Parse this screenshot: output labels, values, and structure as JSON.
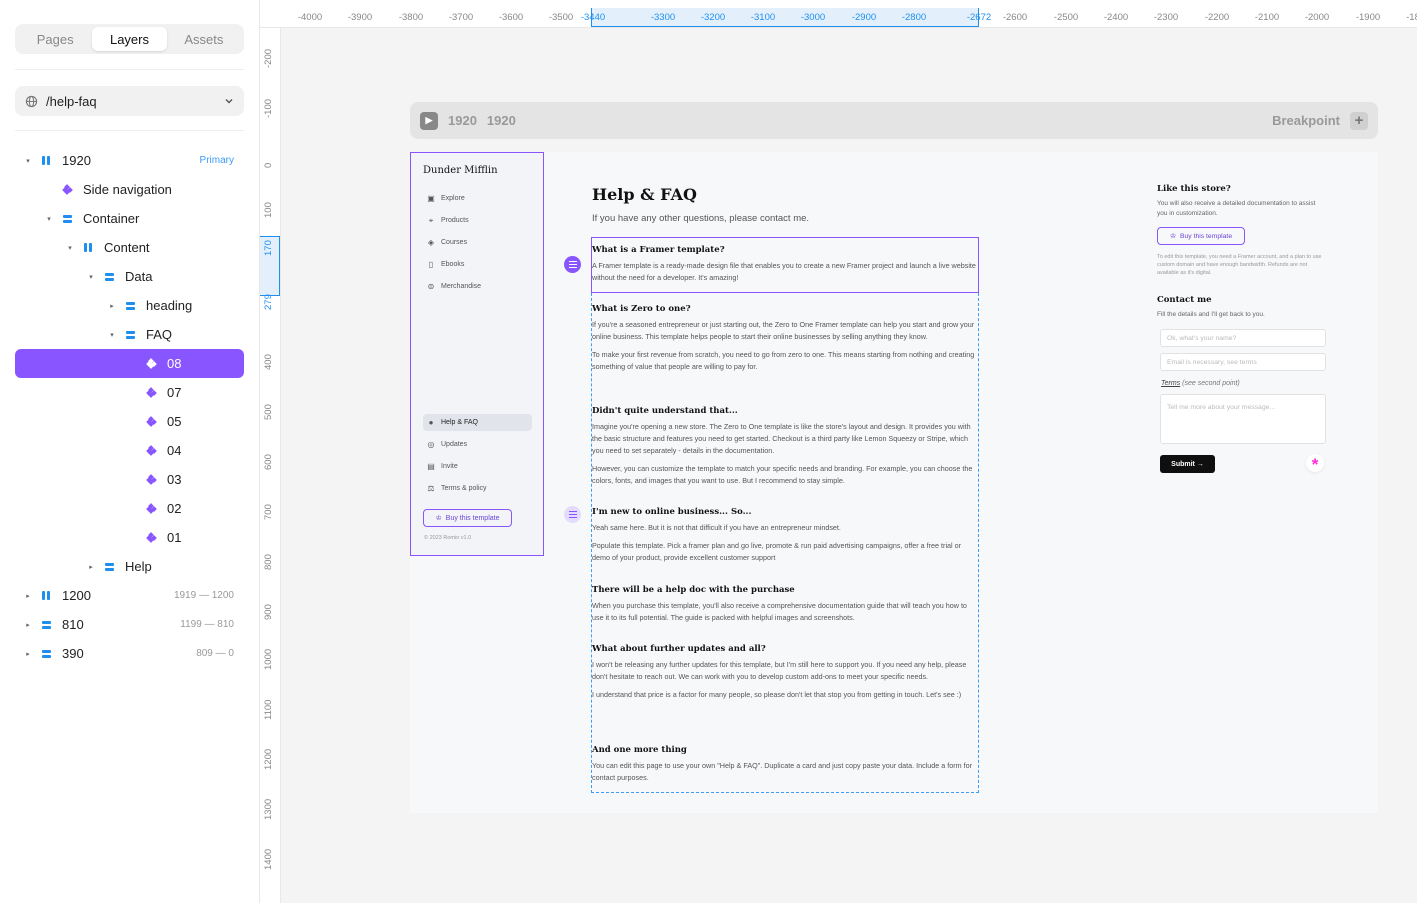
{
  "panel": {
    "tabs": [
      {
        "label": "Pages"
      },
      {
        "label": "Layers"
      },
      {
        "label": "Assets"
      }
    ],
    "page": "/help-faq"
  },
  "layers": [
    {
      "label": "1920",
      "meta": "Primary",
      "icon": "column-stack-icon"
    },
    {
      "label": "Side navigation",
      "meta": "",
      "icon": "component-icon"
    },
    {
      "label": "Container",
      "meta": "",
      "icon": "row-stack-icon"
    },
    {
      "label": "Content",
      "meta": "",
      "icon": "column-stack-icon"
    },
    {
      "label": "Data",
      "meta": "",
      "icon": "row-stack-icon"
    },
    {
      "label": "heading",
      "meta": "",
      "icon": "row-stack-icon"
    },
    {
      "label": "FAQ",
      "meta": "",
      "icon": "row-stack-icon"
    },
    {
      "label": "08",
      "meta": "",
      "icon": "component-icon",
      "selected": true
    },
    {
      "label": "07",
      "meta": "",
      "icon": "component-icon"
    },
    {
      "label": "05",
      "meta": "",
      "icon": "component-icon"
    },
    {
      "label": "04",
      "meta": "",
      "icon": "component-icon"
    },
    {
      "label": "03",
      "meta": "",
      "icon": "component-icon"
    },
    {
      "label": "02",
      "meta": "",
      "icon": "component-icon"
    },
    {
      "label": "01",
      "meta": "",
      "icon": "component-icon"
    },
    {
      "label": "Help",
      "meta": "",
      "icon": "row-stack-icon"
    },
    {
      "label": "1200",
      "meta": "1919 — 1200",
      "icon": "column-stack-icon"
    },
    {
      "label": "810",
      "meta": "1199 — 810",
      "icon": "row-stack-icon"
    },
    {
      "label": "390",
      "meta": "809 — 0",
      "icon": "row-stack-icon"
    }
  ],
  "ruler_top": [
    "-4000",
    "-3900",
    "-3800",
    "-3700",
    "-3600",
    "-3500",
    "-3440",
    "-3300",
    "-3200",
    "-3100",
    "-3000",
    "-2900",
    "-2800",
    "-2672",
    "-2600",
    "-2500",
    "-2400",
    "-2300",
    "-2200",
    "-2100",
    "-2000",
    "-1900",
    "-18"
  ],
  "ruler_left": [
    "-200",
    "-100",
    "0",
    "100",
    "170",
    "279",
    "400",
    "500",
    "600",
    "700",
    "800",
    "900",
    "1000",
    "1100",
    "1200",
    "1300",
    "1400"
  ],
  "frame_bar": {
    "width1": "1920",
    "width2": "1920",
    "breakpoint": "Breakpoint",
    "plus": "+"
  },
  "site": {
    "brand": "Dunder Mifflin",
    "nav_top": [
      {
        "label": "Explore",
        "icon": "explore-icon"
      },
      {
        "label": "Products",
        "icon": "products-icon"
      },
      {
        "label": "Courses",
        "icon": "courses-icon"
      },
      {
        "label": "Ebooks",
        "icon": "ebooks-icon"
      },
      {
        "label": "Merchandise",
        "icon": "merchandise-icon"
      }
    ],
    "nav_bottom": [
      {
        "label": "Help & FAQ",
        "icon": "info-icon"
      },
      {
        "label": "Updates",
        "icon": "updates-icon"
      },
      {
        "label": "Invite",
        "icon": "invite-icon"
      },
      {
        "label": "Terms & policy",
        "icon": "terms-icon"
      }
    ],
    "buy_button": "Buy this template",
    "copyright": "© 2023 Romio v1.0",
    "title": "Help & FAQ",
    "subtitle": "If you have any other questions, please contact me.",
    "faqs": [
      {
        "q": "What is a Framer template?",
        "a": [
          "A Framer template is a ready-made design file that enables you to create a new Framer project and launch a live website without the need for a developer. It's amazing!"
        ]
      },
      {
        "q": "What is Zero to one?",
        "a": [
          "If you're a seasoned entrepreneur or just starting out, the Zero to One Framer template can help you start and grow your online business. This template helps people to start their online businesses by selling anything they know.",
          "To make your first revenue from scratch, you need to go from zero to one. This means starting from nothing and creating something of value that people are willing to pay for."
        ]
      },
      {
        "q": "Didn't quite understand that...",
        "a": [
          "Imagine you're opening a new store. The Zero to One template is like the store's layout and design. It provides you with the basic structure and features you need to get started. Checkout is a third party like Lemon Squeezy or Stripe, which you need to set separately - details in the documentation.",
          "However, you can customize the template to match your specific needs and branding. For example, you can choose the colors, fonts, and images that you want to use. But I recommend to stay simple."
        ]
      },
      {
        "q": "I'm new to online business... So...",
        "a": [
          "Yeah same here. But it is not that difficult if you have an entrepreneur mindset.",
          "Populate this template. Pick a framer plan and go live, promote & run paid advertising campaigns, offer a free trial or demo of your product, provide excellent customer support"
        ]
      },
      {
        "q": "There will be a help doc with the purchase",
        "a": [
          "When you purchase this template, you'll also receive a comprehensive documentation guide that will teach you how to use it to its full potential. The guide is packed with helpful images and screenshots."
        ]
      },
      {
        "q": "What about further updates and all?",
        "a": [
          "I won't be releasing any further updates for this template, but I'm still here to support you. If you need any help, please don't hesitate to reach out. We can work with you to develop custom add-ons to meet your specific needs.",
          "I understand that price is a factor for many people, so please don't let that stop you from getting in touch. Let's see :)"
        ]
      },
      {
        "q": "And one more thing",
        "a": [
          "You can edit this page to use your own \"Help & FAQ\". Duplicate a card and just copy paste your data. Include a form for contact purposes."
        ]
      }
    ],
    "aside": {
      "store_title": "Like this store?",
      "store_text": "You will also receive a detailed documentation to assist you in customization.",
      "buy_button": "Buy this template",
      "store_note": "To edit this template, you need a Framer account, and a plan to use custom domain and have enough bandwidth. Refunds are not available as it's digital.",
      "contact_title": "Contact me",
      "contact_text": "Fill the details and I'll get back to you.",
      "name_placeholder": "Ok, what's your name?",
      "email_placeholder": "Email is necessary, see terms",
      "terms_link": "Terms",
      "terms_hint": "(see second point)",
      "message_placeholder": "Tell me more about your message...",
      "submit": "Submit",
      "submit_arrow": "→",
      "asterisk": "*"
    }
  },
  "colors": {
    "accent": "#8855ff",
    "blue": "#1f8fef",
    "pink": "#ff2bd6"
  }
}
